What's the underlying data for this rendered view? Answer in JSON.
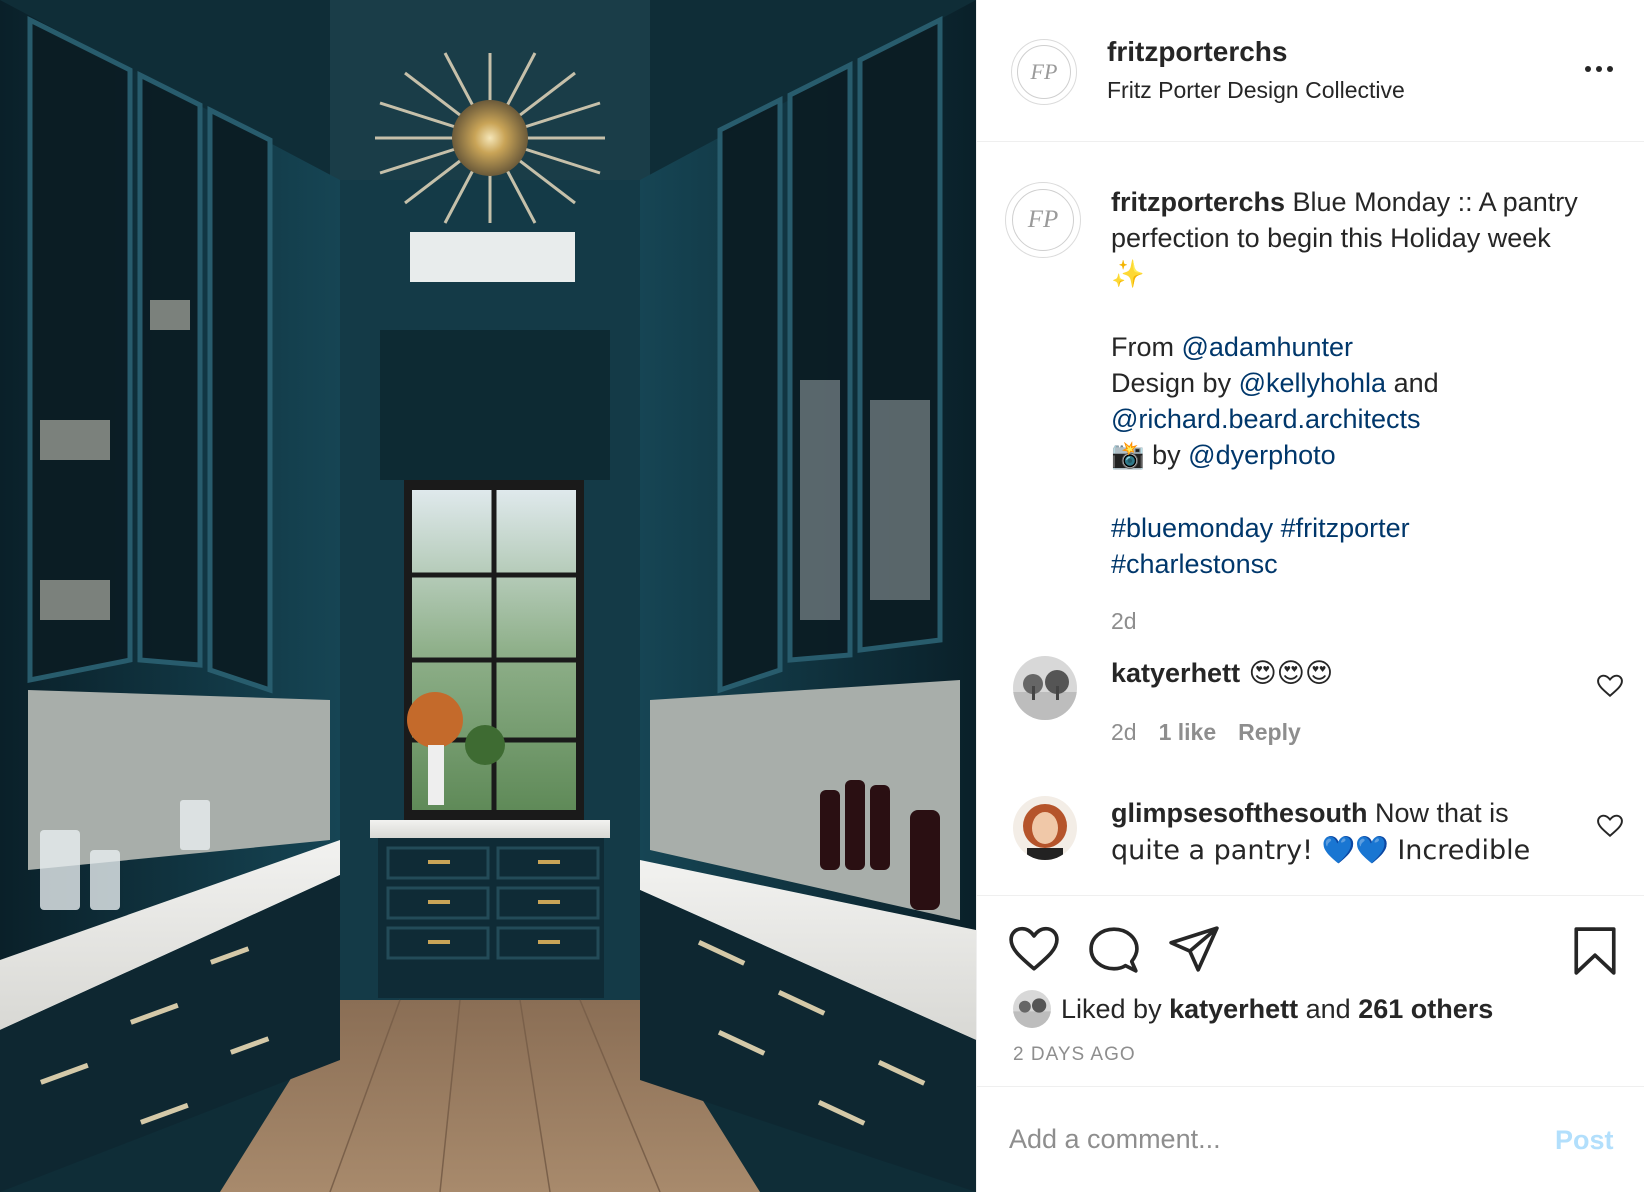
{
  "post": {
    "photo_alt": "Blue lacquered butler's pantry with sputnik chandelier"
  },
  "header": {
    "avatar_monogram": "FP",
    "username": "fritzporterchs",
    "subtitle": "Fritz Porter Design Collective",
    "more_icon": "more-horizontal-icon"
  },
  "caption": {
    "username": "fritzporterchs",
    "line1": " Blue Monday :: A pantry perfection to begin this Holiday week",
    "sparkles": "✨",
    "from_label": "From ",
    "from_link": "@adamhunter",
    "design_label": "Design by ",
    "design_link": "@kellyhohla",
    "design_and": " and",
    "architect_link": "@richard.beard.architects",
    "camera": "📸",
    "photo_by": " by ",
    "photo_link": "@dyerphoto",
    "hashtags_1": "#bluemonday #fritzporter",
    "hashtags_2": "#charlestonsc",
    "time": "2d"
  },
  "comments": [
    {
      "username": "katyerhett",
      "text": " 😍😍😍",
      "time": "2d",
      "likes": "1 like",
      "reply": "Reply"
    },
    {
      "username": "glimpsesofthesouth",
      "text": " Now that is",
      "text_line2": "quite a pantry! 💙💙 Incredible"
    }
  ],
  "actions": {
    "like_icon": "heart-icon",
    "comment_icon": "comment-icon",
    "share_icon": "paper-plane-icon",
    "save_icon": "bookmark-icon"
  },
  "likes": {
    "prefix": "Liked by ",
    "user": "katyerhett",
    "middle": " and ",
    "others": "261 others"
  },
  "date": "2 DAYS AGO",
  "add_comment": {
    "placeholder": "Add a comment...",
    "post_label": "Post"
  },
  "colors": {
    "link": "#00376b",
    "post_disabled": "#b2dffc",
    "muted": "#8e8e8e",
    "pantry_blue": "#123845"
  }
}
